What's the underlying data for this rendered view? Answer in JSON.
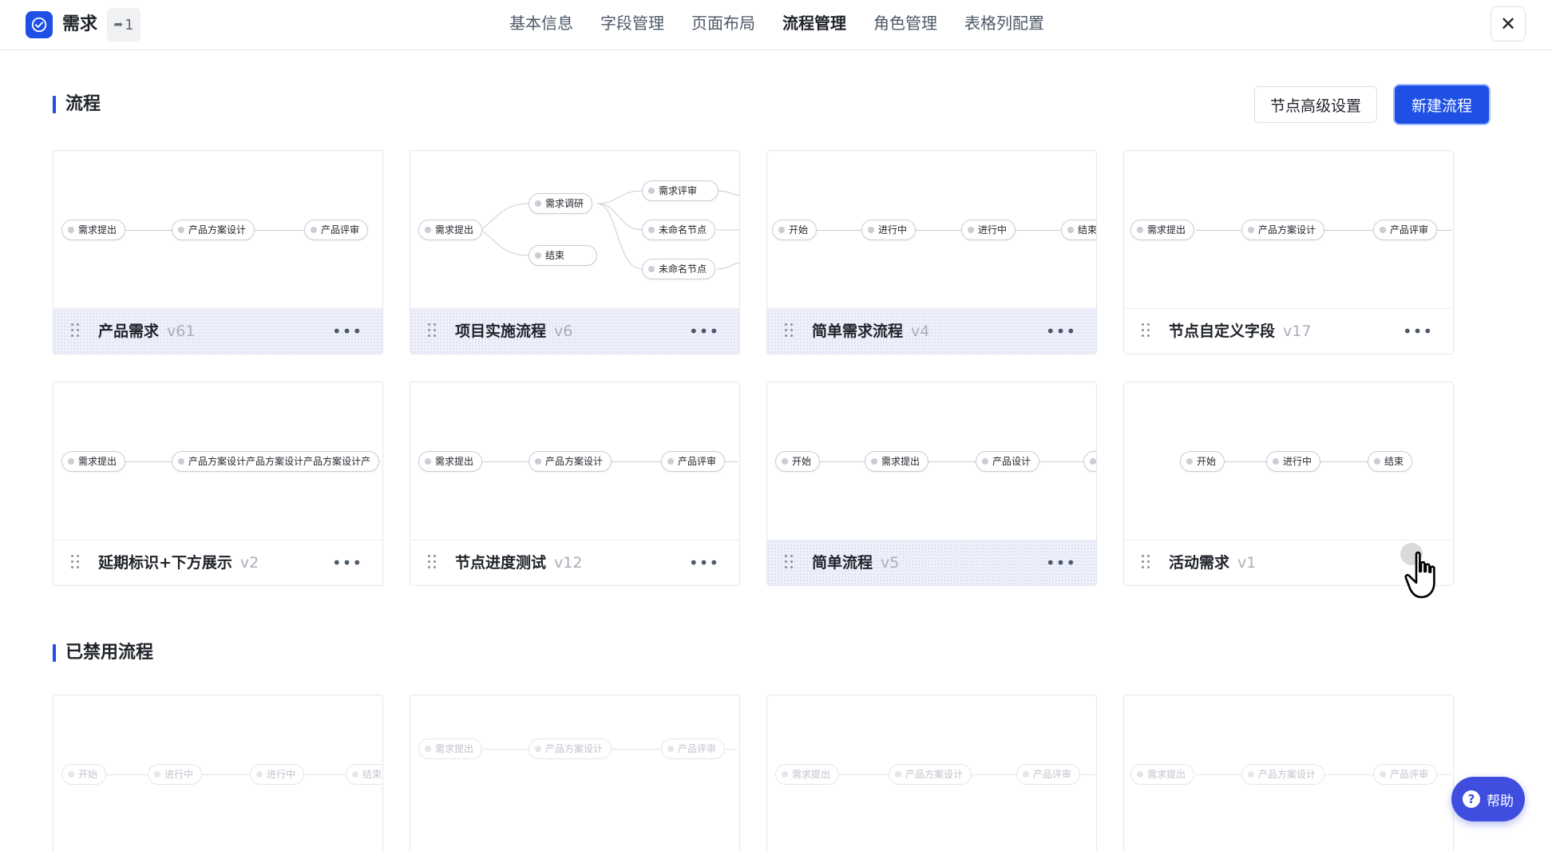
{
  "header": {
    "app_title": "需求",
    "share_count": "1",
    "tabs": [
      "基本信息",
      "字段管理",
      "页面布局",
      "流程管理",
      "角色管理",
      "表格列配置"
    ],
    "active_tab": "流程管理",
    "close_label": "✕"
  },
  "section_flows": {
    "title": "流程",
    "advanced_button": "节点高级设置",
    "new_button": "新建流程"
  },
  "section_disabled": {
    "title": "已禁用流程"
  },
  "flows": [
    {
      "name": "产品需求",
      "version": "v61",
      "nodes": [
        "需求提出",
        "产品方案设计",
        "产品评审"
      ]
    },
    {
      "name": "项目实施流程",
      "version": "v6",
      "nodes": [
        "需求提出",
        "需求调研",
        "结束",
        "需求评审",
        "未命名节点",
        "未命名节点"
      ]
    },
    {
      "name": "简单需求流程",
      "version": "v4",
      "nodes": [
        "开始",
        "进行中",
        "进行中",
        "结束"
      ]
    },
    {
      "name": "节点自定义字段",
      "version": "v17",
      "nodes": [
        "需求提出",
        "产品方案设计",
        "产品评审"
      ]
    },
    {
      "name": "延期标识+下方展示",
      "version": "v2",
      "nodes": [
        "需求提出",
        "产品方案设计产品方案设计产品方案设计产"
      ]
    },
    {
      "name": "节点进度测试",
      "version": "v12",
      "nodes": [
        "需求提出",
        "产品方案设计",
        "产品评审"
      ]
    },
    {
      "name": "简单流程",
      "version": "v5",
      "nodes": [
        "开始",
        "需求提出",
        "产品设计"
      ]
    },
    {
      "name": "活动需求",
      "version": "v1",
      "nodes": [
        "开始",
        "进行中",
        "结束"
      ]
    }
  ],
  "disabled_flows": [
    {
      "nodes": [
        "开始",
        "进行中",
        "进行中",
        "结束"
      ]
    },
    {
      "nodes": [
        "需求提出",
        "产品方案设计",
        "产品评审"
      ]
    },
    {
      "nodes": [
        "需求提出",
        "产品方案设计",
        "产品评审"
      ]
    },
    {
      "nodes": [
        "需求提出",
        "产品方案设计",
        "产品评审"
      ]
    }
  ],
  "help": {
    "label": "帮助",
    "icon": "?"
  },
  "colors": {
    "primary": "#1e50e6",
    "help": "#3f4ede",
    "highlight": "#eef0fb"
  }
}
